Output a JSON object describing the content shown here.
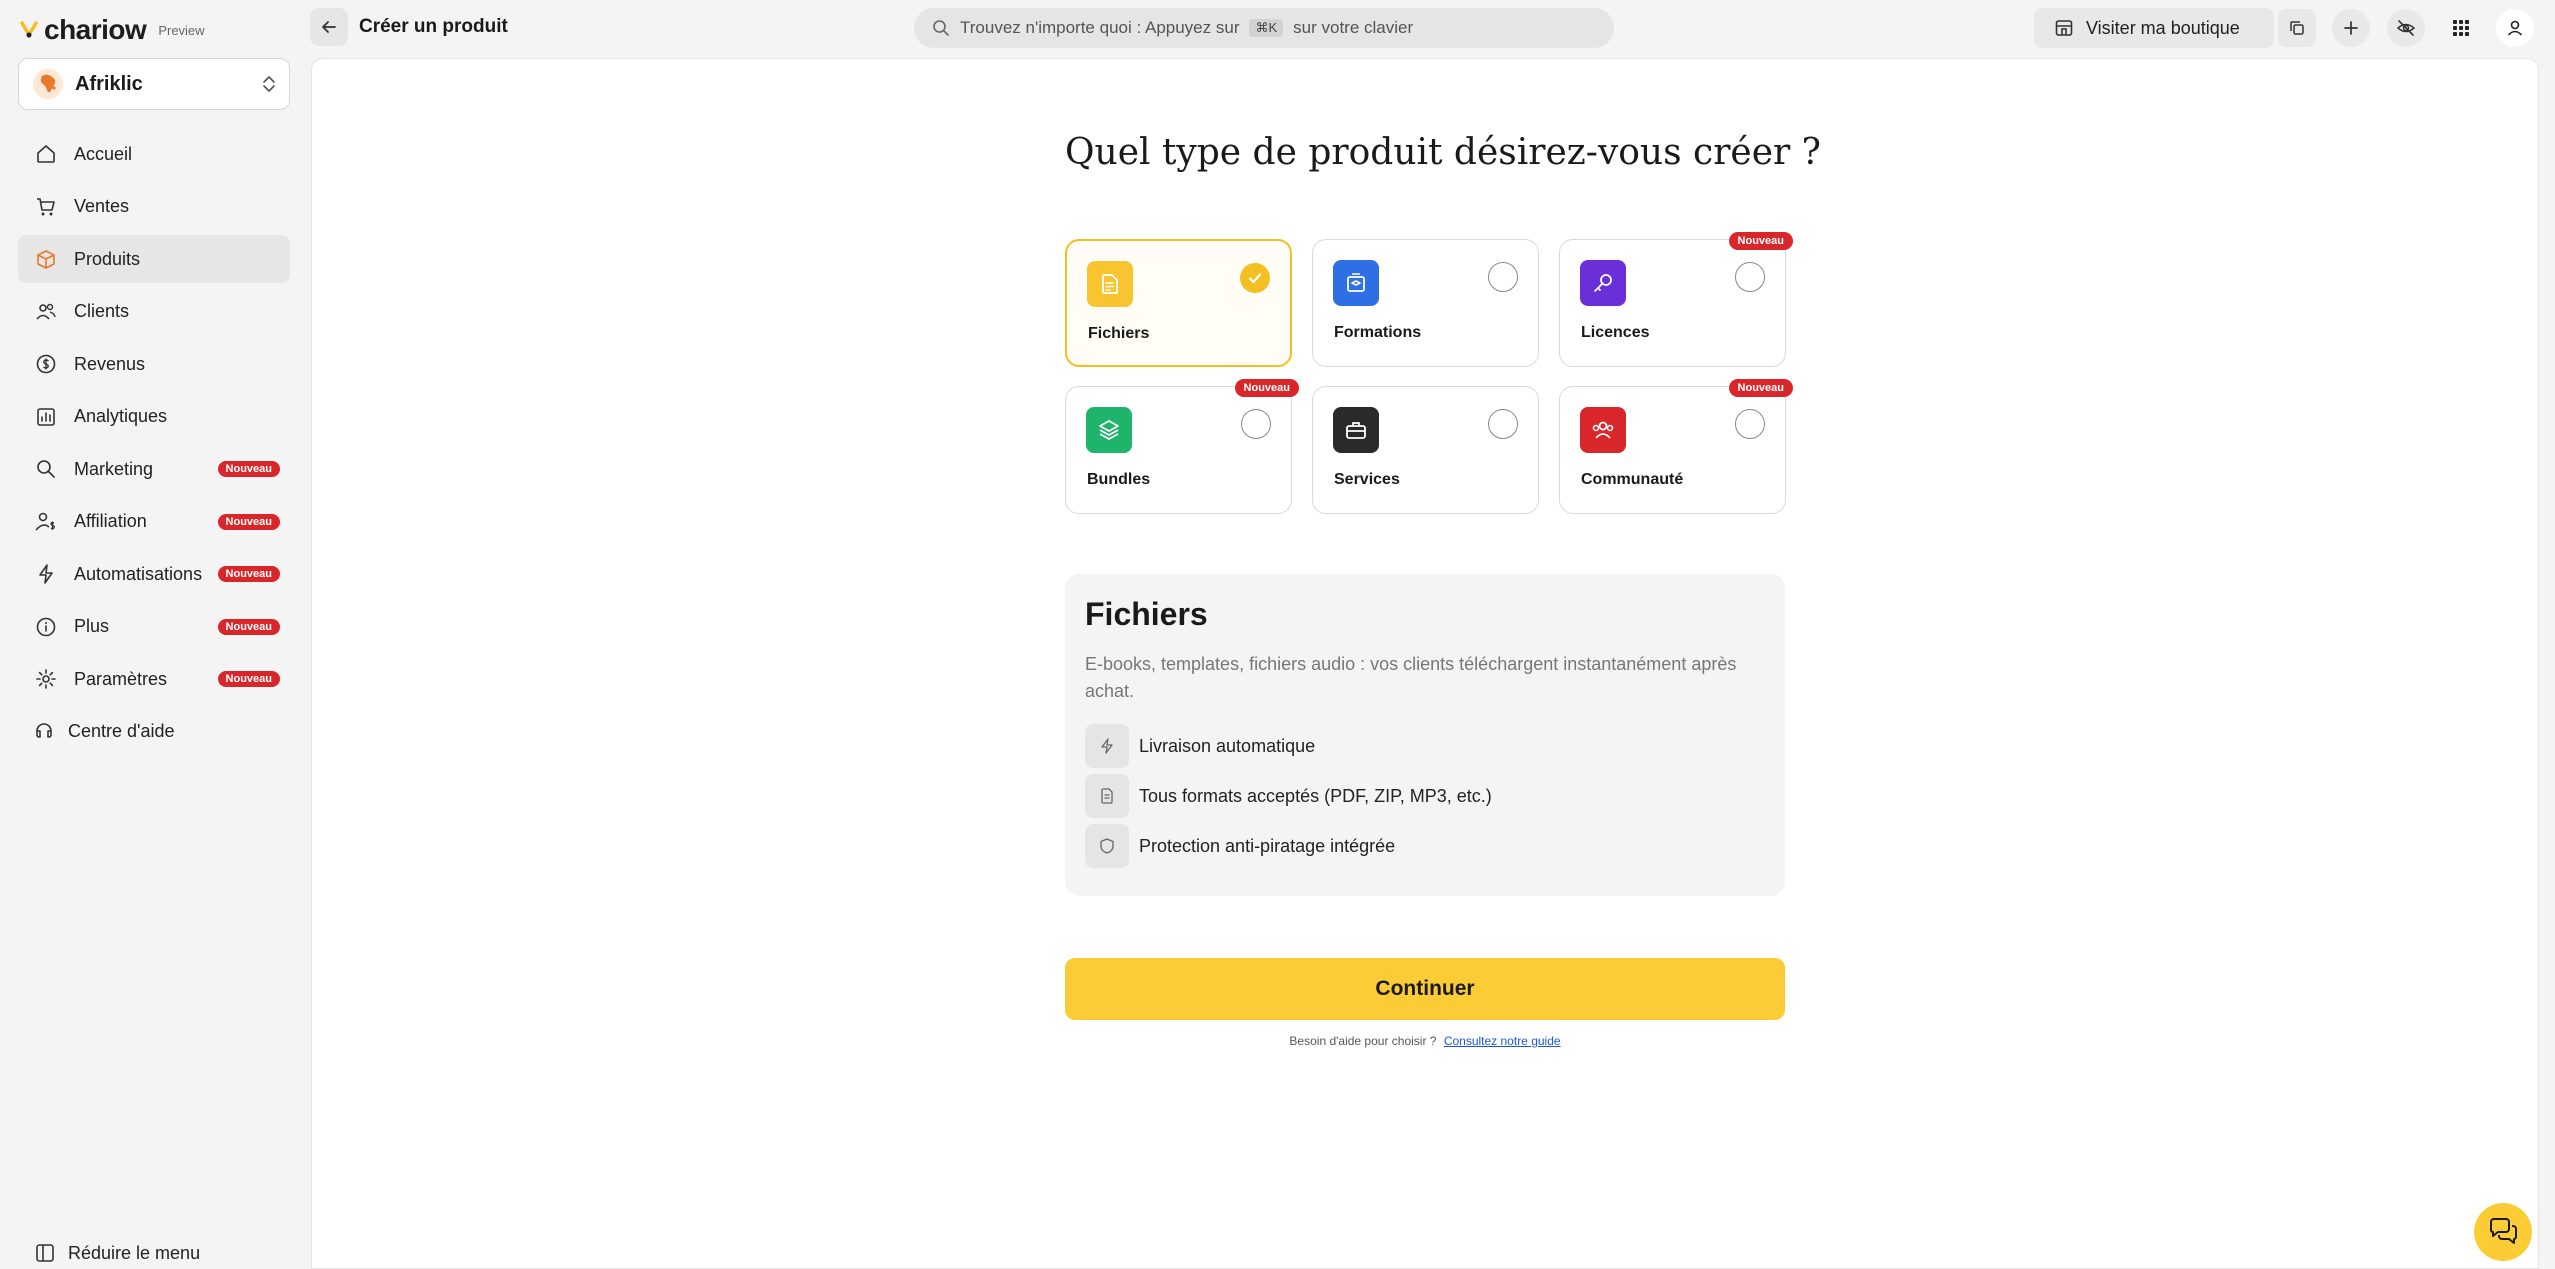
{
  "brand": {
    "name": "chariow",
    "tag": "Preview"
  },
  "header": {
    "title": "Créer un produit",
    "search_prefix": "Trouvez n'importe quoi : Appuyez sur",
    "search_shortcut": "⌘K",
    "search_suffix": "sur votre clavier",
    "visit_label": "Visiter ma boutique"
  },
  "store": {
    "name": "Afriklic",
    "avatar": "AfriKlic"
  },
  "sidebar": {
    "items": [
      {
        "label": "Accueil",
        "icon": "home-icon"
      },
      {
        "label": "Ventes",
        "icon": "cart-icon"
      },
      {
        "label": "Produits",
        "icon": "box-icon",
        "active": true
      },
      {
        "label": "Clients",
        "icon": "users-icon"
      },
      {
        "label": "Revenus",
        "icon": "dollar-icon"
      },
      {
        "label": "Analytiques",
        "icon": "chart-icon"
      },
      {
        "label": "Marketing",
        "icon": "megaphone-icon",
        "badge": "Nouveau"
      },
      {
        "label": "Affiliation",
        "icon": "user-dollar-icon",
        "badge": "Nouveau"
      },
      {
        "label": "Automatisations",
        "icon": "bolt-icon",
        "badge": "Nouveau"
      },
      {
        "label": "Plus",
        "icon": "info-icon",
        "badge": "Nouveau"
      },
      {
        "label": "Paramètres",
        "icon": "gear-icon",
        "badge": "Nouveau"
      },
      {
        "label": "Centre d'aide",
        "icon": "help-icon"
      }
    ],
    "collapse_label": "Réduire le menu"
  },
  "main": {
    "question": "Quel type de produit désirez-vous créer ?",
    "product_types": [
      {
        "label": "Fichiers",
        "icon": "file-icon",
        "color": "#f8c531",
        "selected": true
      },
      {
        "label": "Formations",
        "icon": "course-icon",
        "color": "#2f6fe6",
        "selected": false
      },
      {
        "label": "Licences",
        "icon": "key-icon",
        "color": "#6a2fd6",
        "selected": false,
        "badge": "Nouveau"
      },
      {
        "label": "Bundles",
        "icon": "layers-icon",
        "color": "#1fb46b",
        "selected": false,
        "badge": "Nouveau"
      },
      {
        "label": "Services",
        "icon": "briefcase-icon",
        "color": "#2a2a2a",
        "selected": false
      },
      {
        "label": "Communauté",
        "icon": "community-icon",
        "color": "#d9262a",
        "selected": false,
        "badge": "Nouveau"
      }
    ],
    "detail": {
      "title": "Fichiers",
      "description": "E-books, templates, fichiers audio : vos clients téléchargent instantanément après achat.",
      "features": [
        {
          "label": "Livraison automatique",
          "icon": "bolt-icon"
        },
        {
          "label": "Tous formats acceptés (PDF, ZIP, MP3, etc.)",
          "icon": "file-icon"
        },
        {
          "label": "Protection anti-piratage intégrée",
          "icon": "shield-icon"
        }
      ]
    },
    "continue_label": "Continuer",
    "help_text": "Besoin d'aide pour choisir ?",
    "help_link": "Consultez notre guide"
  },
  "colors": {
    "accent": "#fccc36",
    "badge": "#d9262a",
    "link": "#1a56d6"
  }
}
